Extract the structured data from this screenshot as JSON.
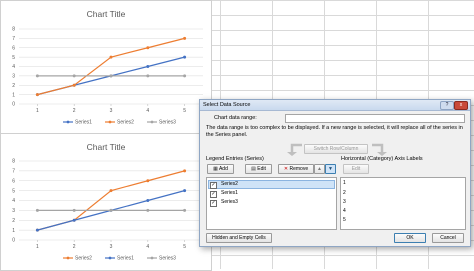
{
  "chart1": {
    "title": "Chart Title",
    "y_ticks": [
      "0",
      "1",
      "2",
      "3",
      "4",
      "5",
      "6",
      "7",
      "8"
    ],
    "x_ticks": [
      "1",
      "2",
      "3",
      "4",
      "5"
    ],
    "legend": [
      "Series1",
      "Series2",
      "Series3"
    ]
  },
  "chart2": {
    "title": "Chart Title",
    "y_ticks": [
      "0",
      "1",
      "2",
      "3",
      "4",
      "5",
      "6",
      "7",
      "8"
    ],
    "x_ticks": [
      "1",
      "2",
      "3",
      "4",
      "5"
    ],
    "legend": [
      "Series2",
      "Series1",
      "Series3"
    ]
  },
  "colors": {
    "series1": "#4472c4",
    "series2": "#ed7d31",
    "series3": "#a5a5a5"
  },
  "chart_data": [
    {
      "type": "line",
      "title": "Chart Title",
      "x": [
        1,
        2,
        3,
        4,
        5
      ],
      "ylim": [
        0,
        8
      ],
      "legend_position": "bottom",
      "series": [
        {
          "name": "Series1",
          "values": [
            1,
            2,
            3,
            4,
            5
          ]
        },
        {
          "name": "Series2",
          "values": [
            1,
            2,
            5,
            6,
            7
          ]
        },
        {
          "name": "Series3",
          "values": [
            3,
            3,
            3,
            3,
            3
          ]
        }
      ]
    },
    {
      "type": "line",
      "title": "Chart Title",
      "x": [
        1,
        2,
        3,
        4,
        5
      ],
      "ylim": [
        0,
        8
      ],
      "legend_position": "bottom",
      "series": [
        {
          "name": "Series2",
          "values": [
            1,
            2,
            5,
            6,
            7
          ]
        },
        {
          "name": "Series1",
          "values": [
            1,
            2,
            3,
            4,
            5
          ]
        },
        {
          "name": "Series3",
          "values": [
            3,
            3,
            3,
            3,
            3
          ]
        }
      ]
    }
  ],
  "dialog": {
    "title": "Select Data Source",
    "help_label": "?",
    "close_label": "x",
    "chart_range_label": "Chart data range:",
    "chart_range_value": "",
    "warning": "The data range is too complex to be displayed. If a new range is selected, it will replace all of the series in the Series panel.",
    "switch_label": "Switch Row/Column",
    "legend_header": "Legend Entries (Series)",
    "axis_header": "Horizontal (Category) Axis Labels",
    "add_label": "Add",
    "edit_label": "Edit",
    "remove_label": "Remove",
    "axis_edit_label": "Edit",
    "series": [
      "Series2",
      "Series1",
      "Series3"
    ],
    "axis_labels": [
      "1",
      "2",
      "3",
      "4",
      "5"
    ],
    "hidden_label": "Hidden and Empty Cells",
    "ok_label": "OK",
    "cancel_label": "Cancel"
  }
}
